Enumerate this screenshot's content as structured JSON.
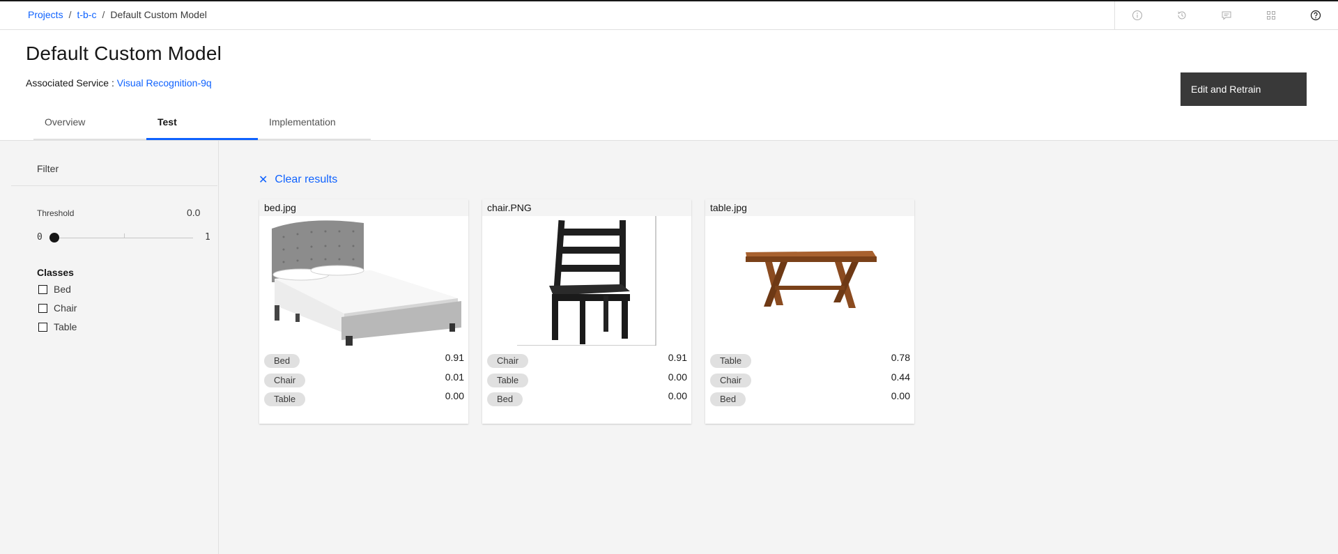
{
  "breadcrumb": {
    "items": [
      "Projects",
      "t-b-c"
    ],
    "separator": "/",
    "current": "Default Custom Model"
  },
  "header_icons": [
    "info-icon",
    "history-icon",
    "chat-icon",
    "apps-icon",
    "help-icon"
  ],
  "page": {
    "title": "Default Custom Model",
    "associated_label": "Associated Service :",
    "service_link": "Visual Recognition-9q",
    "edit_button": "Edit and Retrain"
  },
  "tabs": [
    {
      "label": "Overview",
      "active": false
    },
    {
      "label": "Test",
      "active": true
    },
    {
      "label": "Implementation",
      "active": false
    }
  ],
  "filter": {
    "title": "Filter",
    "threshold_label": "Threshold",
    "threshold_value": "0.0",
    "slider_min": "0",
    "slider_max": "1",
    "slider_level": 0,
    "classes_title": "Classes",
    "classes": [
      "Bed",
      "Chair",
      "Table"
    ]
  },
  "results": {
    "clear_label": "Clear results",
    "clear_icon": "close-icon",
    "cards": [
      {
        "filename": "bed.jpg",
        "image": "bed",
        "predictions": [
          {
            "label": "Bed",
            "score": "0.91"
          },
          {
            "label": "Chair",
            "score": "0.01"
          },
          {
            "label": "Table",
            "score": "0.00"
          }
        ]
      },
      {
        "filename": "chair.PNG",
        "image": "chair",
        "predictions": [
          {
            "label": "Chair",
            "score": "0.91"
          },
          {
            "label": "Table",
            "score": "0.00"
          },
          {
            "label": "Bed",
            "score": "0.00"
          }
        ]
      },
      {
        "filename": "table.jpg",
        "image": "table",
        "predictions": [
          {
            "label": "Table",
            "score": "0.78"
          },
          {
            "label": "Chair",
            "score": "0.44"
          },
          {
            "label": "Bed",
            "score": "0.00"
          }
        ]
      }
    ]
  },
  "colors": {
    "link": "#0f62fe",
    "active_tab": "#0f62fe",
    "button_bg": "#393939",
    "tag_bg": "#e0e0e0"
  }
}
